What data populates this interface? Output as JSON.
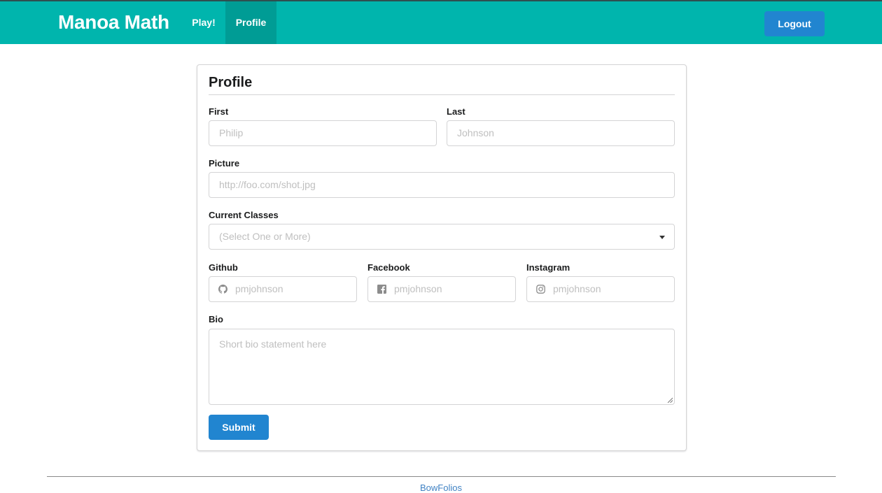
{
  "navbar": {
    "brand": "Manoa Math",
    "items": [
      {
        "label": "Play!"
      },
      {
        "label": "Profile"
      }
    ],
    "logout_label": "Logout",
    "color": "#00b5ad",
    "active_color": "#009c95"
  },
  "form": {
    "title": "Profile",
    "first": {
      "label": "First",
      "placeholder": "Philip"
    },
    "last": {
      "label": "Last",
      "placeholder": "Johnson"
    },
    "picture": {
      "label": "Picture",
      "placeholder": "http://foo.com/shot.jpg"
    },
    "classes": {
      "label": "Current Classes",
      "placeholder": "(Select One or More)"
    },
    "github": {
      "label": "Github",
      "placeholder": "pmjohnson",
      "icon": "github-icon"
    },
    "facebook": {
      "label": "Facebook",
      "placeholder": "pmjohnson",
      "icon": "facebook-icon"
    },
    "instagram": {
      "label": "Instagram",
      "placeholder": "pmjohnson",
      "icon": "instagram-icon"
    },
    "bio": {
      "label": "Bio",
      "placeholder": "Short bio statement here"
    },
    "submit_label": "Submit",
    "button_color": "#2185d0"
  },
  "footer": {
    "link": "BowFolios"
  }
}
